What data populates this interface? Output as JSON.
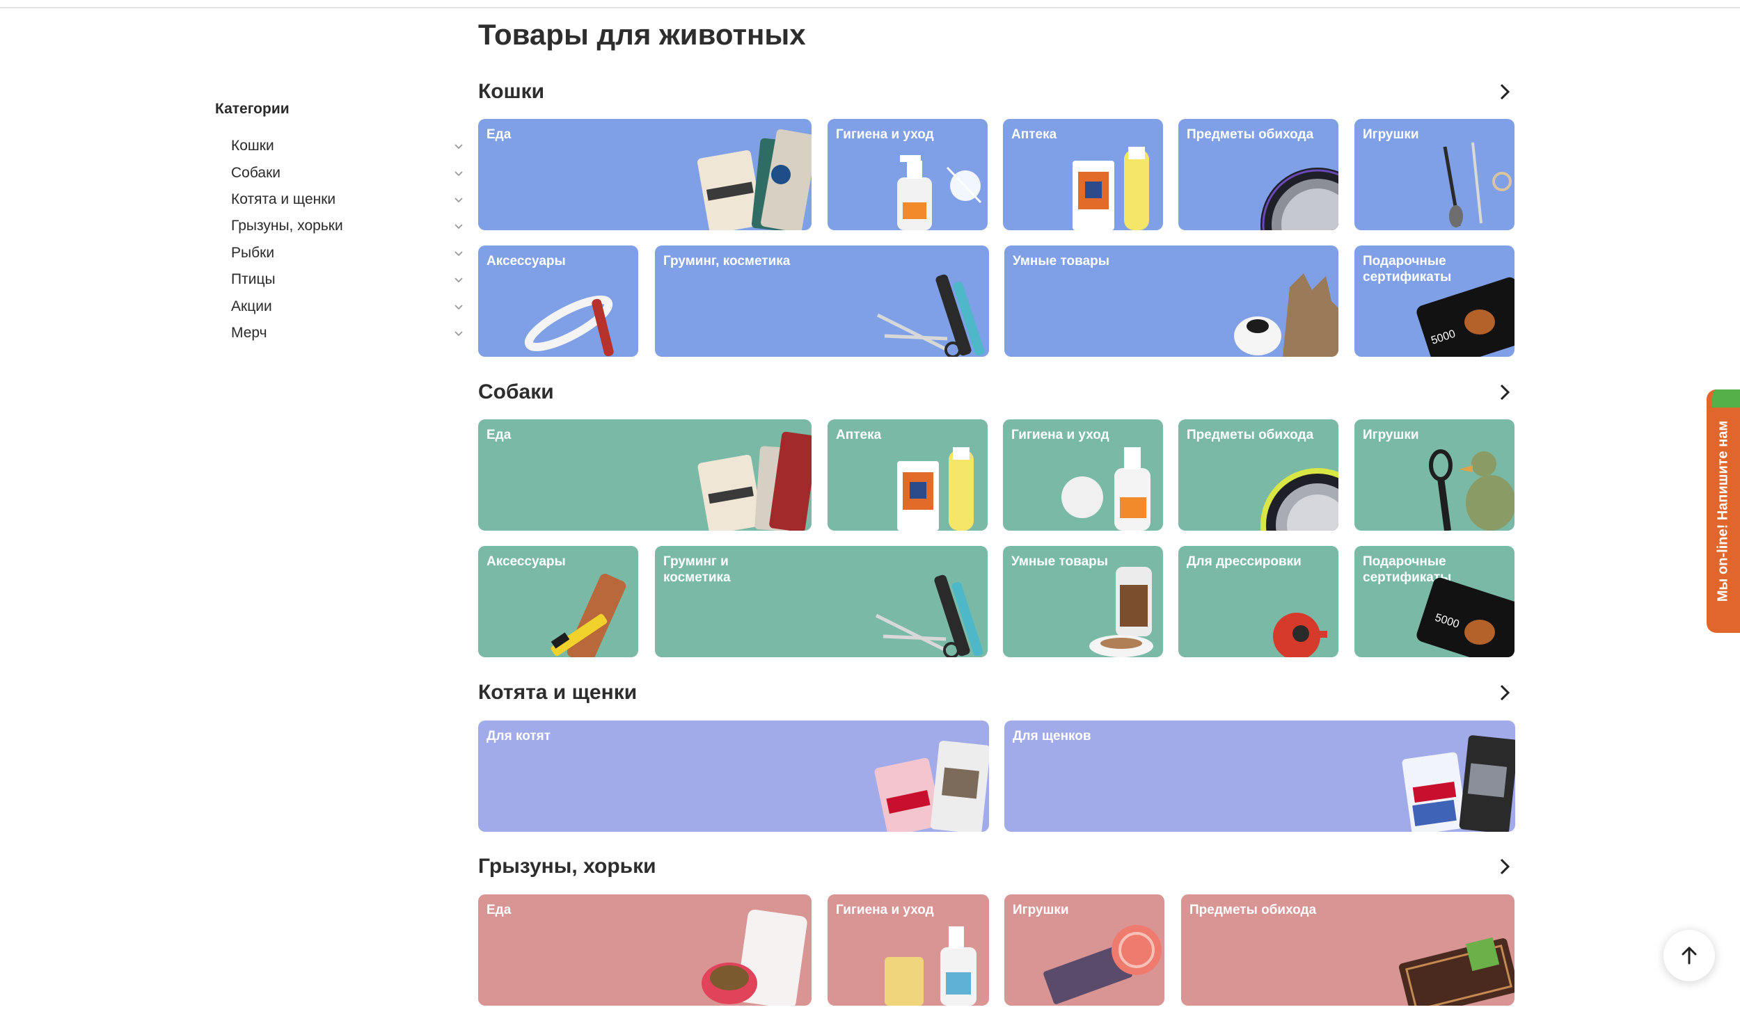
{
  "page": {
    "title": "Товары для животных"
  },
  "sidebar": {
    "title": "Категории",
    "items": [
      {
        "label": "Кошки"
      },
      {
        "label": "Собаки"
      },
      {
        "label": "Котята и щенки"
      },
      {
        "label": "Грызуны, хорьки"
      },
      {
        "label": "Рыбки"
      },
      {
        "label": "Птицы"
      },
      {
        "label": "Акции"
      },
      {
        "label": "Мерч"
      }
    ]
  },
  "sections": [
    {
      "title": "Кошки",
      "color": "#7f9fe6",
      "tiles": [
        {
          "label": "Еда",
          "icon": "cat-food-packs-icon"
        },
        {
          "label": "Гигиена и уход",
          "icon": "spray-bottle-icon"
        },
        {
          "label": "Аптека",
          "icon": "medicine-icon"
        },
        {
          "label": "Предметы обихода",
          "icon": "bowl-icon"
        },
        {
          "label": "Игрушки",
          "icon": "teaser-wand-icon"
        },
        {
          "label": "Аксессуары",
          "icon": "collar-icon"
        },
        {
          "label": "Груминг, косметика",
          "icon": "scissors-comb-icon"
        },
        {
          "label": "Умные товары",
          "icon": "smart-toy-cat-icon"
        },
        {
          "label": "Подарочные сертификаты",
          "icon": "gift-card-icon",
          "card_value": "5000"
        }
      ]
    },
    {
      "title": "Собаки",
      "color": "#79b9a6",
      "tiles": [
        {
          "label": "Еда",
          "icon": "dog-food-packs-icon"
        },
        {
          "label": "Аптека",
          "icon": "medicine-icon"
        },
        {
          "label": "Гигиена и уход",
          "icon": "spray-bottle-icon"
        },
        {
          "label": "Предметы обихода",
          "icon": "bowl-icon"
        },
        {
          "label": "Игрушки",
          "icon": "plush-toy-icon"
        },
        {
          "label": "Аксессуары",
          "icon": "leather-collar-icon"
        },
        {
          "label": "Груминг и косметика",
          "icon": "scissors-comb-icon"
        },
        {
          "label": "Умные товары",
          "icon": "food-dispenser-icon"
        },
        {
          "label": "Для дрессировки",
          "icon": "training-toy-icon"
        },
        {
          "label": "Подарочные сертификаты",
          "icon": "gift-card-icon",
          "card_value": "5000"
        }
      ]
    },
    {
      "title": "Котята и щенки",
      "color": "#a2abe9",
      "tiles": [
        {
          "label": "Для котят",
          "icon": "kitten-food-icon"
        },
        {
          "label": "Для щенков",
          "icon": "puppy-food-icon"
        }
      ]
    },
    {
      "title": "Грызуны, хорьки",
      "color": "#d99494",
      "tiles": [
        {
          "label": "Еда",
          "icon": "rodent-food-icon"
        },
        {
          "label": "Гигиена и уход",
          "icon": "spray-bottle-icon"
        },
        {
          "label": "Игрушки",
          "icon": "chew-toy-icon"
        },
        {
          "label": "Предметы обихода",
          "icon": "cage-tray-icon"
        }
      ]
    }
  ],
  "chat": {
    "label": "Мы on-line! Напишите нам"
  },
  "scroll_top": {
    "icon": "arrow-up-icon"
  }
}
